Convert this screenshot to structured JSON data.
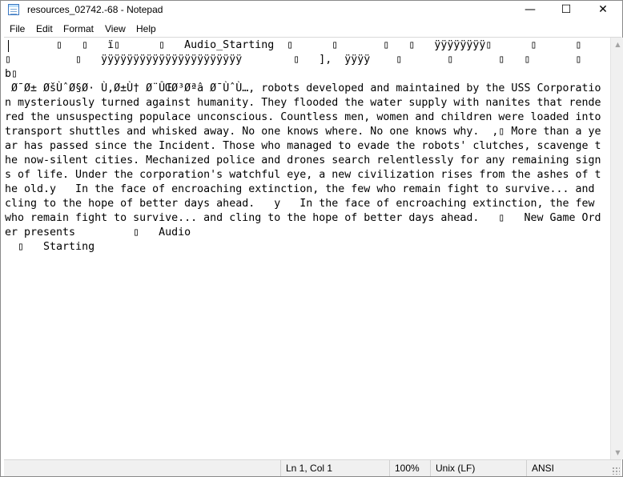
{
  "window": {
    "title": "resources_02742.-68 - Notepad",
    "minimize_glyph": "—",
    "maximize_glyph": "☐",
    "close_glyph": "✕"
  },
  "menu": {
    "file": "File",
    "edit": "Edit",
    "format": "Format",
    "view": "View",
    "help": "Help"
  },
  "editor": {
    "content": "        ▯   ▯   ï▯      ▯   Audio_Starting  ▯      ▯       ▯   ▯   ÿÿÿÿÿÿÿÿ▯      ▯      ▯\n▯          ▯   ÿÿÿÿÿÿÿÿÿÿÿÿÿÿÿÿÿÿÿÿÿÿ        ▯   ],  ÿÿÿÿ    ▯       ▯       ▯   ▯       ▯   b▯\n Ø¯Ø± ØšÙˆØ§Ø· Ù‚Ø±Ù† Ø¨ÛŒØ³Øªâ Ø¯ÙˆÙ…, robots developed and maintained by the USS Corporation mysteriously turned against humanity. They flooded the water supply with nanites that rendered the unsuspecting populace unconscious. Countless men, women and children were loaded into transport shuttles and whisked away. No one knows where. No one knows why.  ,▯ More than a year has passed since the Incident. Those who managed to evade the robots' clutches, scavenge the now-silent cities. Mechanized police and drones search relentlessly for any remaining signs of life. Under the corporation's watchful eye, a new civilization rises from the ashes of the old.y   In the face of encroaching extinction, the few who remain fight to survive... and cling to the hope of better days ahead.   y   In the face of encroaching extinction, the few who remain fight to survive... and cling to the hope of better days ahead.   ▯   New Game Order presents         ▯   Audio\n  ▯   Starting"
  },
  "status": {
    "position": "Ln 1, Col 1",
    "zoom": "100%",
    "line_endings": "Unix (LF)",
    "encoding": "ANSI"
  }
}
